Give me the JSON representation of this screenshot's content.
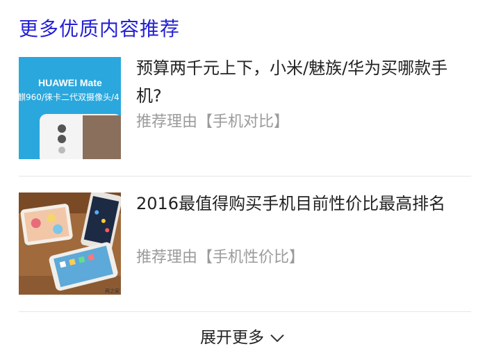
{
  "section": {
    "title": "更多优质内容推荐"
  },
  "cards": [
    {
      "title": "预算两千元上下，小米/魅族/华为买哪款手机?",
      "reason": "推荐理由【手机对比】",
      "thumb_text_1": "HUAWEI Mate",
      "thumb_text_2": "麒960/徕卡二代双摄像头/4"
    },
    {
      "title": "2016最值得购买手机目前性价比最高排名",
      "reason": "推荐理由【手机性价比】",
      "thumb_watermark": "两之家"
    }
  ],
  "expand": {
    "label": "展开更多",
    "icon": "chevron-down-icon"
  },
  "colors": {
    "title_blue": "#2320d4",
    "reason_gray": "#9b9b9b",
    "thumb_blue": "#2aa7dd"
  }
}
